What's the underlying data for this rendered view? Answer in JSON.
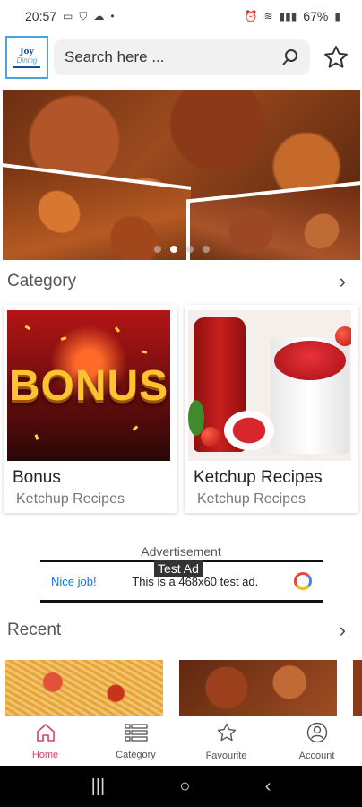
{
  "status_bar": {
    "time": "20:57",
    "battery": "67%",
    "left_icons": [
      "laptop-icon",
      "shield-icon",
      "cloud-icon",
      "dot-icon"
    ],
    "right_icons": [
      "alarm-icon",
      "wifi-icon",
      "volte-icon",
      "signal-icon",
      "battery-icon"
    ]
  },
  "header": {
    "logo_top": "Joy",
    "logo_mid": "Dining",
    "search_placeholder": "Search here ...",
    "search_icon": "search-icon",
    "favourite_icon": "star-icon"
  },
  "banner": {
    "slides": 4,
    "active_slide": 2
  },
  "category": {
    "title": "Category",
    "cards": [
      {
        "image_text": "BONUS",
        "title": "Bonus",
        "subtitle": "Ketchup Recipes"
      },
      {
        "title": "Ketchup Recipes",
        "subtitle": "Ketchup Recipes"
      }
    ]
  },
  "ad": {
    "label": "Advertisement",
    "tag": "Test Ad",
    "nice": "Nice job!",
    "description": "This is a 468x60 test ad."
  },
  "recent": {
    "title": "Recent"
  },
  "bottom_nav": {
    "items": [
      {
        "label": "Home",
        "icon": "home-icon",
        "active": true
      },
      {
        "label": "Category",
        "icon": "list-icon",
        "active": false
      },
      {
        "label": "Favourite",
        "icon": "star-icon",
        "active": false
      },
      {
        "label": "Account",
        "icon": "account-icon",
        "active": false
      }
    ]
  },
  "colors": {
    "accent": "#d63d72",
    "logo_border": "#4aa3df",
    "ad_link": "#1a73e8"
  }
}
